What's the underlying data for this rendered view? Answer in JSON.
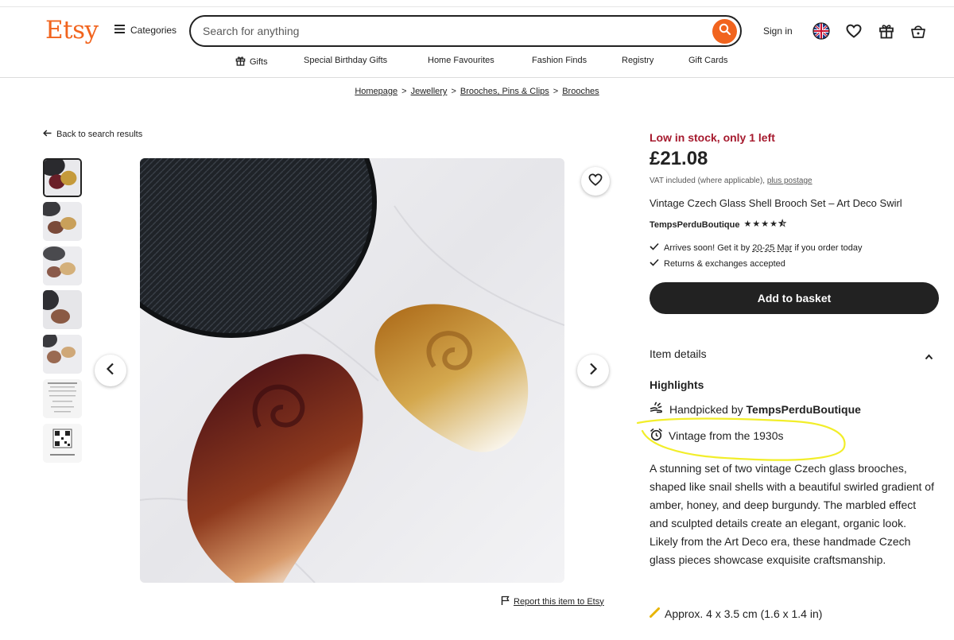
{
  "header": {
    "logo": "Etsy",
    "categories_label": "Categories",
    "search_placeholder": "Search for anything",
    "signin_label": "Sign in",
    "nav": [
      "Gifts",
      "Special Birthday Gifts",
      "Home Favourites",
      "Fashion Finds",
      "Registry",
      "Gift Cards"
    ]
  },
  "breadcrumb": [
    "Homepage",
    "Jewellery",
    "Brooches, Pins & Clips",
    "Brooches"
  ],
  "gallery": {
    "back_label": "Back to search results",
    "report_label": "Report this item to Etsy"
  },
  "product": {
    "stock": "Low in stock, only 1 left",
    "price": "£21.08",
    "vat_text": "VAT included (where applicable),",
    "vat_link": "plus postage",
    "title": "Vintage Czech Glass Shell Brooch Set – Art Deco Swirl",
    "shop": "TempsPerduBoutique",
    "stars": "★★★★⯪",
    "arrives_prefix": "Arrives soon! Get it by",
    "arrives_date": "20-25 Mar",
    "arrives_suffix": "if you order today",
    "returns": "Returns & exchanges accepted",
    "basket_label": "Add to basket"
  },
  "details": {
    "section_label": "Item details",
    "highlights_label": "Highlights",
    "handpicked_prefix": "Handpicked by",
    "handpicked_shop": "TempsPerduBoutique",
    "vintage": "Vintage from the 1930s",
    "description": "A stunning set of two vintage Czech glass brooches, shaped like snail shells with a beautiful swirled gradient of amber, honey, and deep burgundy. The marbled effect and sculpted details create an elegant, organic look. Likely from the Art Deco era, these handmade Czech glass pieces showcase exquisite craftsmanship.",
    "size": "Approx. 4 x 3.5 cm (1.6 x 1.4 in)"
  },
  "colors": {
    "brand_orange": "#f1641e",
    "stock_red": "#a61a2e",
    "highlight_yellow": "#f2ee2a"
  },
  "icons": [
    "hamburger-icon",
    "search-icon",
    "globe-icon",
    "heart-icon",
    "gift-icon",
    "basket-icon",
    "arrow-left-icon",
    "chevron-left-icon",
    "chevron-right-icon",
    "flag-icon",
    "check-icon",
    "chevron-up-icon",
    "hand-icon",
    "alarm-clock-icon",
    "ruler-icon"
  ]
}
